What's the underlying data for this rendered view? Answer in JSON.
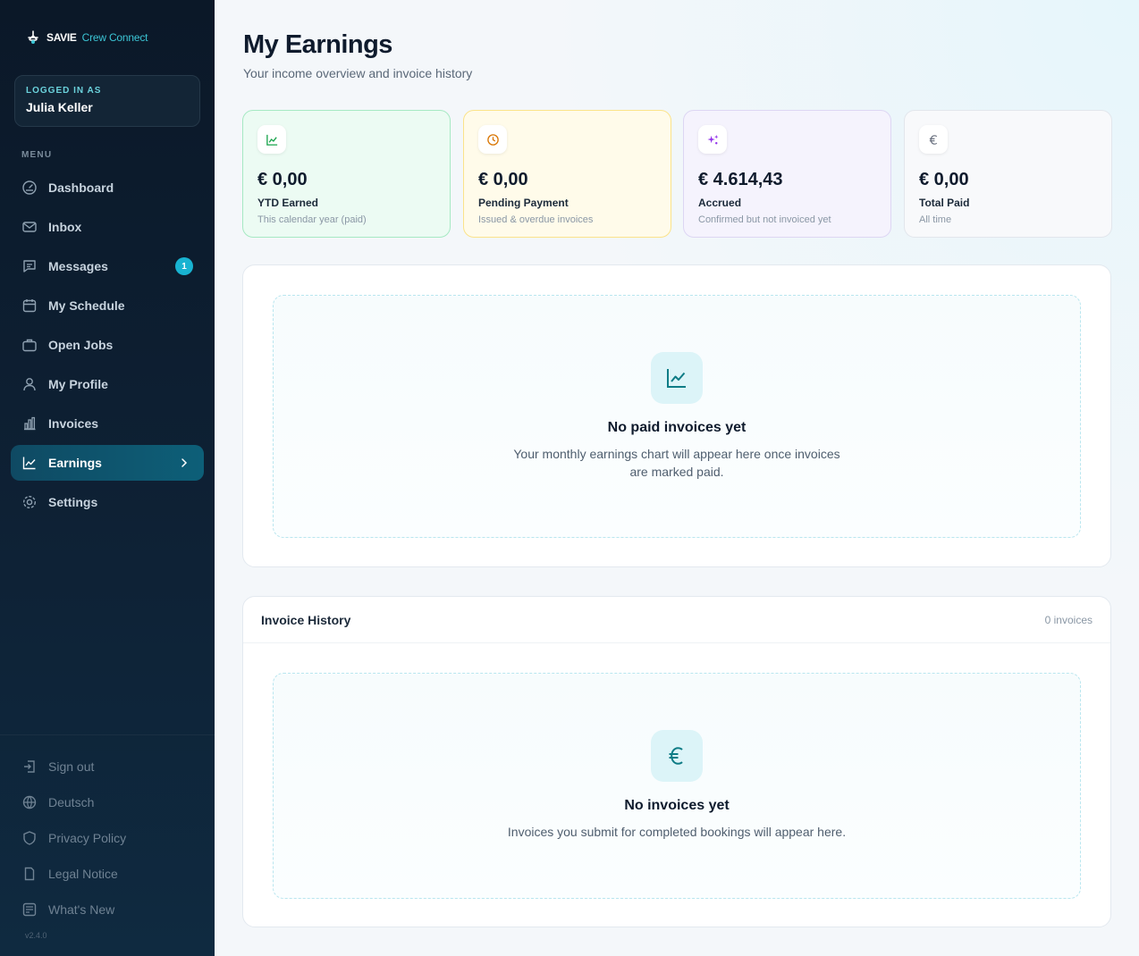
{
  "brand": {
    "name": "SAVIE",
    "product": "Crew Connect"
  },
  "user": {
    "label": "LOGGED IN AS",
    "name": "Julia Keller"
  },
  "sidebar": {
    "menu_title": "MENU",
    "items": [
      {
        "label": "Dashboard",
        "icon": "dashboard-icon"
      },
      {
        "label": "Inbox",
        "icon": "inbox-icon",
        "badge": "1"
      },
      {
        "label": "Messages",
        "icon": "messages-icon"
      },
      {
        "label": "My Schedule",
        "icon": "calendar-icon"
      },
      {
        "label": "Open Jobs",
        "icon": "briefcase-icon"
      },
      {
        "label": "My Profile",
        "icon": "user-icon"
      },
      {
        "label": "Invoices",
        "icon": "bar-chart-icon"
      },
      {
        "label": "Earnings",
        "icon": "line-chart-icon",
        "active": true
      },
      {
        "label": "Settings",
        "icon": "gear-icon"
      }
    ],
    "footer": [
      {
        "label": "Sign out",
        "icon": "sign-out-icon"
      },
      {
        "label": "Deutsch",
        "icon": "globe-icon"
      },
      {
        "label": "Privacy Policy",
        "icon": "shield-icon"
      },
      {
        "label": "Legal Notice",
        "icon": "document-icon"
      },
      {
        "label": "What's New",
        "icon": "news-icon"
      }
    ],
    "version": "v2.4.0"
  },
  "page": {
    "title": "My Earnings",
    "subtitle": "Your income overview and invoice history"
  },
  "stats": [
    {
      "value": "€ 0,00",
      "label": "YTD Earned",
      "hint": "This calendar year (paid)",
      "icon": "line-chart-icon",
      "accent": "#16a34a"
    },
    {
      "value": "€ 0,00",
      "label": "Pending Payment",
      "hint": "Issued & overdue invoices",
      "icon": "clock-icon",
      "accent": "#d97706"
    },
    {
      "value": "€ 4.614,43",
      "label": "Accrued",
      "hint": "Confirmed but not invoiced yet",
      "icon": "sparkles-icon",
      "accent": "#9333ea"
    },
    {
      "value": "€ 0,00",
      "label": "Total Paid",
      "hint": "All time",
      "icon": "euro-icon",
      "accent": "#6b7280"
    }
  ],
  "chart_empty": {
    "title": "No paid invoices yet",
    "description_line1": "Your monthly earnings chart will appear here once invoices",
    "description_line2": "are marked paid."
  },
  "invoice_history": {
    "title": "Invoice History",
    "count": "0 invoices",
    "empty_title": "No invoices yet",
    "empty_description": "Invoices you submit for completed bookings will appear here."
  },
  "colors": {
    "accent": "#0d5f78",
    "badge": "#18b3d1",
    "empty_icon": "#0e7c86"
  }
}
